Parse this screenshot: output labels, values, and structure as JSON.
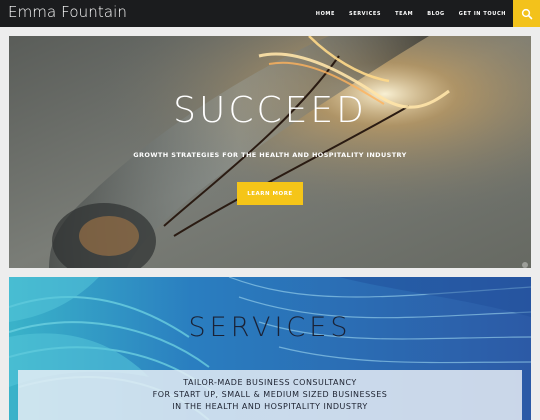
{
  "brand": {
    "name": "Emma Fountain"
  },
  "nav": {
    "items": [
      {
        "label": "HOME"
      },
      {
        "label": "SERVICES"
      },
      {
        "label": "TEAM"
      },
      {
        "label": "BLOG"
      },
      {
        "label": "GET IN TOUCH"
      }
    ],
    "search_icon": "search-icon",
    "accent": "#f3c21b"
  },
  "hero": {
    "title": "SUCCEED",
    "subtitle": "GROWTH STRATEGIES FOR THE HEALTH AND HOSPITALITY INDUSTRY",
    "button_label": "LEARN MORE",
    "button_color": "#f5c518"
  },
  "services": {
    "title": "SERVICES",
    "lines": [
      "TAILOR-MADE BUSINESS CONSULTANCY",
      "FOR START UP, SMALL & MEDIUM SIZED BUSINESSES",
      "IN THE HEALTH AND HOSPITALITY INDUSTRY"
    ]
  }
}
